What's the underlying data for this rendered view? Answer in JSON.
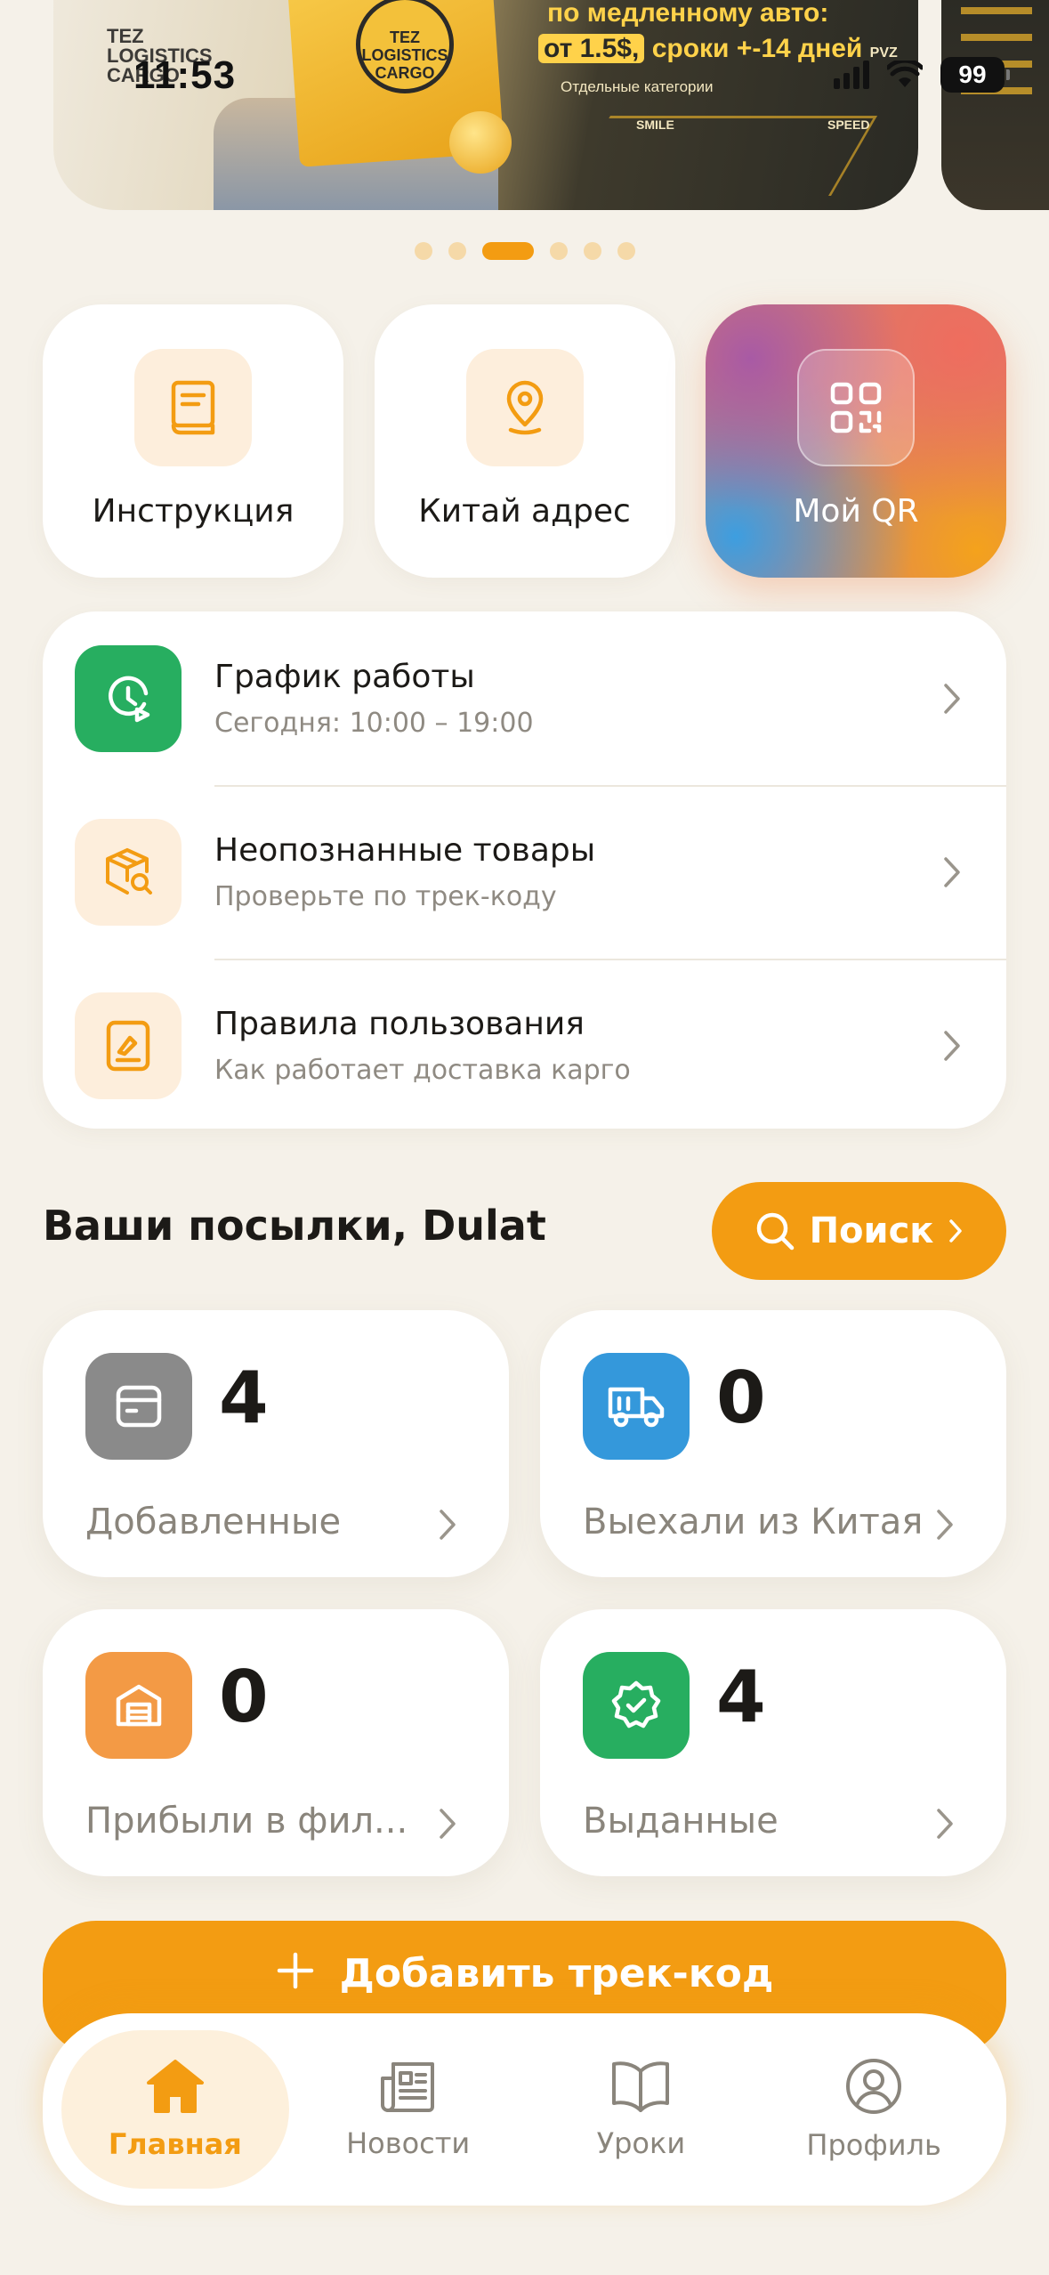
{
  "status_bar": {
    "time": "11:53",
    "battery": "99"
  },
  "banner": {
    "sign_text": "TEZ LOGISTICS CARGO",
    "logo_text": "TEZ LOGISTICS CARGO",
    "promo_line1": "по медленному авто:",
    "promo_price": "от 1.5$,",
    "promo_line2": "сроки +-14 дней",
    "promo_line2_tag": "PVZ",
    "promo_line3": "Отдельные категории",
    "map_label_left": "SMILE",
    "map_label_right": "SPEED",
    "carousel_pages": 6,
    "carousel_active_index": 2
  },
  "quick_actions": [
    {
      "label": "Инструкция",
      "icon": "book-icon"
    },
    {
      "label": "Китай адрес",
      "icon": "location-pin-icon"
    },
    {
      "label": "Мой QR",
      "icon": "qr-code-icon"
    }
  ],
  "info_list": [
    {
      "title": "График работы",
      "subtitle": "Сегодня: 10:00 – 19:00",
      "icon": "clock-icon",
      "icon_color": "#27ae60"
    },
    {
      "title": "Неопознанные товары",
      "subtitle": "Проверьте по трек-коду",
      "icon": "package-search-icon"
    },
    {
      "title": "Правила пользования",
      "subtitle": "Как работает доставка карго",
      "icon": "rules-document-icon"
    }
  ],
  "parcels": {
    "title": "Ваши посылки, Dulat",
    "search_label": "Поиск",
    "stats": [
      {
        "label": "Добавленные",
        "value": "4",
        "icon": "box-icon",
        "color": "#8a8a8a"
      },
      {
        "label": "Выехали из Китая",
        "value": "0",
        "icon": "truck-icon",
        "color": "#3498db"
      },
      {
        "label": "Прибыли в фил...",
        "value": "0",
        "icon": "warehouse-icon",
        "color": "#f39a45"
      },
      {
        "label": "Выданные",
        "value": "4",
        "icon": "verified-badge-icon",
        "color": "#27ae60"
      }
    ]
  },
  "add_tracking_label": "Добавить трек-код",
  "bottom_nav": [
    {
      "label": "Главная",
      "icon": "home-icon",
      "active": true
    },
    {
      "label": "Новости",
      "icon": "newspaper-icon",
      "active": false
    },
    {
      "label": "Уроки",
      "icon": "open-book-icon",
      "active": false
    },
    {
      "label": "Профиль",
      "icon": "user-circle-icon",
      "active": false
    }
  ],
  "colors": {
    "accent": "#f39c12",
    "background": "#f5f1e9",
    "green": "#27ae60",
    "blue": "#3498db",
    "gray": "#8a8a8a"
  }
}
